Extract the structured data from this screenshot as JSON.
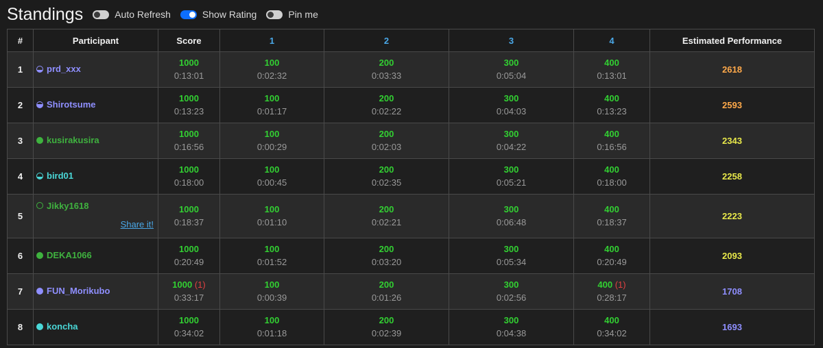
{
  "header": {
    "title": "Standings",
    "toggles": [
      {
        "label": "Auto Refresh",
        "on": false
      },
      {
        "label": "Show Rating",
        "on": true
      },
      {
        "label": "Pin me",
        "on": false
      }
    ]
  },
  "table": {
    "columns": [
      "#",
      "Participant",
      "Score",
      "1",
      "2",
      "3",
      "4",
      "Estimated Performance"
    ],
    "rows": [
      {
        "rank": "1",
        "user": "prd_xxx",
        "color": "#8f8fff",
        "icon": "half",
        "fill": 0.35,
        "score": {
          "pts": "1000",
          "pen": "",
          "time": "0:13:01"
        },
        "tasks": [
          {
            "pts": "100",
            "pen": "",
            "time": "0:02:32"
          },
          {
            "pts": "200",
            "pen": "",
            "time": "0:03:33"
          },
          {
            "pts": "300",
            "pen": "",
            "time": "0:05:04"
          },
          {
            "pts": "400",
            "pen": "",
            "time": "0:13:01"
          }
        ],
        "perf": "2618",
        "perf_color": "#ffa94a",
        "share": ""
      },
      {
        "rank": "2",
        "user": "Shirotsume",
        "color": "#8f8fff",
        "icon": "half",
        "fill": 0.6,
        "score": {
          "pts": "1000",
          "pen": "",
          "time": "0:13:23"
        },
        "tasks": [
          {
            "pts": "100",
            "pen": "",
            "time": "0:01:17"
          },
          {
            "pts": "200",
            "pen": "",
            "time": "0:02:22"
          },
          {
            "pts": "300",
            "pen": "",
            "time": "0:04:03"
          },
          {
            "pts": "400",
            "pen": "",
            "time": "0:13:23"
          }
        ],
        "perf": "2593",
        "perf_color": "#ffa94a",
        "share": ""
      },
      {
        "rank": "3",
        "user": "kusirakusira",
        "color": "#3fb23f",
        "icon": "full",
        "fill": 1,
        "score": {
          "pts": "1000",
          "pen": "",
          "time": "0:16:56"
        },
        "tasks": [
          {
            "pts": "100",
            "pen": "",
            "time": "0:00:29"
          },
          {
            "pts": "200",
            "pen": "",
            "time": "0:02:03"
          },
          {
            "pts": "300",
            "pen": "",
            "time": "0:04:22"
          },
          {
            "pts": "400",
            "pen": "",
            "time": "0:16:56"
          }
        ],
        "perf": "2343",
        "perf_color": "#e8e84a",
        "share": ""
      },
      {
        "rank": "4",
        "user": "bird01",
        "color": "#4ad8d8",
        "icon": "half",
        "fill": 0.4,
        "score": {
          "pts": "1000",
          "pen": "",
          "time": "0:18:00"
        },
        "tasks": [
          {
            "pts": "100",
            "pen": "",
            "time": "0:00:45"
          },
          {
            "pts": "200",
            "pen": "",
            "time": "0:02:35"
          },
          {
            "pts": "300",
            "pen": "",
            "time": "0:05:21"
          },
          {
            "pts": "400",
            "pen": "",
            "time": "0:18:00"
          }
        ],
        "perf": "2258",
        "perf_color": "#e8e84a",
        "share": ""
      },
      {
        "rank": "5",
        "user": "Jikky1618",
        "color": "#3fb23f",
        "icon": "empty",
        "fill": 0,
        "score": {
          "pts": "1000",
          "pen": "",
          "time": "0:18:37"
        },
        "tasks": [
          {
            "pts": "100",
            "pen": "",
            "time": "0:01:10"
          },
          {
            "pts": "200",
            "pen": "",
            "time": "0:02:21"
          },
          {
            "pts": "300",
            "pen": "",
            "time": "0:06:48"
          },
          {
            "pts": "400",
            "pen": "",
            "time": "0:18:37"
          }
        ],
        "perf": "2223",
        "perf_color": "#e8e84a",
        "share": "Share it!"
      },
      {
        "rank": "6",
        "user": "DEKA1066",
        "color": "#3fb23f",
        "icon": "full",
        "fill": 1,
        "score": {
          "pts": "1000",
          "pen": "",
          "time": "0:20:49"
        },
        "tasks": [
          {
            "pts": "100",
            "pen": "",
            "time": "0:01:52"
          },
          {
            "pts": "200",
            "pen": "",
            "time": "0:03:20"
          },
          {
            "pts": "300",
            "pen": "",
            "time": "0:05:34"
          },
          {
            "pts": "400",
            "pen": "",
            "time": "0:20:49"
          }
        ],
        "perf": "2093",
        "perf_color": "#e8e84a",
        "share": ""
      },
      {
        "rank": "7",
        "user": "FUN_Morikubo",
        "color": "#8f8fff",
        "icon": "full",
        "fill": 1,
        "score": {
          "pts": "1000",
          "pen": "(1)",
          "time": "0:33:17"
        },
        "tasks": [
          {
            "pts": "100",
            "pen": "",
            "time": "0:00:39"
          },
          {
            "pts": "200",
            "pen": "",
            "time": "0:01:26"
          },
          {
            "pts": "300",
            "pen": "",
            "time": "0:02:56"
          },
          {
            "pts": "400",
            "pen": "(1)",
            "time": "0:28:17"
          }
        ],
        "perf": "1708",
        "perf_color": "#8f8fff",
        "share": ""
      },
      {
        "rank": "8",
        "user": "koncha",
        "color": "#4ad8d8",
        "icon": "full",
        "fill": 1,
        "score": {
          "pts": "1000",
          "pen": "",
          "time": "0:34:02"
        },
        "tasks": [
          {
            "pts": "100",
            "pen": "",
            "time": "0:01:18"
          },
          {
            "pts": "200",
            "pen": "",
            "time": "0:02:39"
          },
          {
            "pts": "300",
            "pen": "",
            "time": "0:04:38"
          },
          {
            "pts": "400",
            "pen": "",
            "time": "0:34:02"
          }
        ],
        "perf": "1693",
        "perf_color": "#8f8fff",
        "share": ""
      }
    ]
  }
}
